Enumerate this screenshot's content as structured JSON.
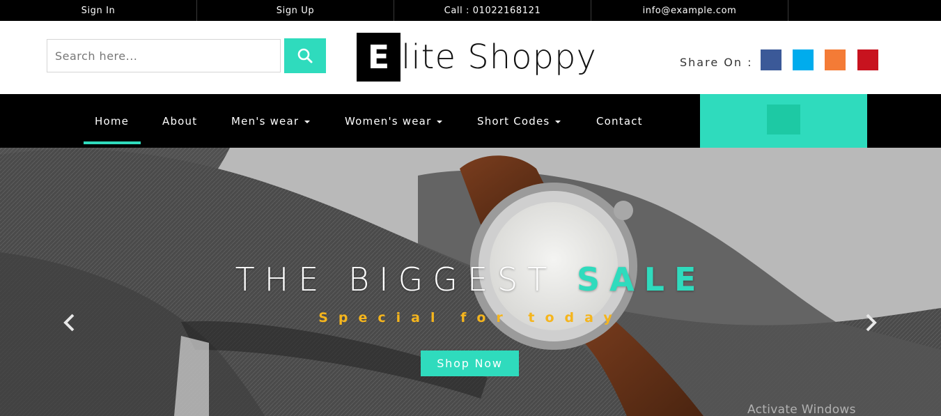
{
  "topbar": {
    "sign_in": "Sign In",
    "sign_up": "Sign Up",
    "call": "Call : 01022168121",
    "email": "info@example.com"
  },
  "header": {
    "search_placeholder": "Search here...",
    "logo_letter": "E",
    "logo_rest": "lite Shoppy",
    "share_label": "Share On :",
    "social": [
      {
        "name": "facebook",
        "color": "#3b5998"
      },
      {
        "name": "twitter",
        "color": "#00aced"
      },
      {
        "name": "rss",
        "color": "#f47b36"
      },
      {
        "name": "pinterest",
        "color": "#c8131f"
      }
    ]
  },
  "nav": {
    "items": [
      {
        "label": "Home",
        "active": true,
        "dropdown": false
      },
      {
        "label": "About",
        "active": false,
        "dropdown": false
      },
      {
        "label": "Men's wear",
        "active": false,
        "dropdown": true
      },
      {
        "label": "Women's wear",
        "active": false,
        "dropdown": true
      },
      {
        "label": "Short Codes",
        "active": false,
        "dropdown": true
      },
      {
        "label": "Contact",
        "active": false,
        "dropdown": false
      }
    ]
  },
  "hero": {
    "title_main": "THE BIGGEST ",
    "title_accent": "SALE",
    "subtitle": "Special for today",
    "button": "Shop Now"
  },
  "watermark": "Activate Windows",
  "colors": {
    "accent": "#2fdbbd",
    "cart_button": "#1dc9a4",
    "subtitle": "#f5b51d"
  }
}
